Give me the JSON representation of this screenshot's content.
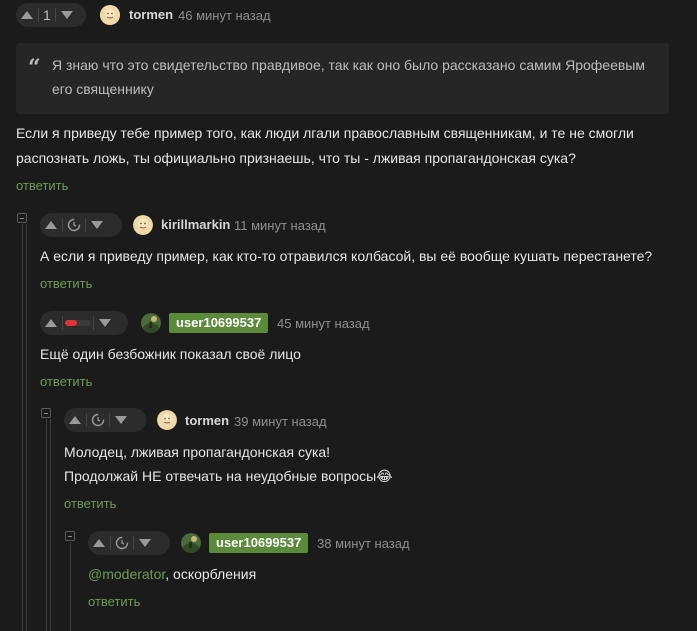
{
  "comments": [
    {
      "id": "c1",
      "rating": "1",
      "author": "tormen",
      "time": "46 минут назад",
      "quote": "Я знаю что это свидетельство правдивое, так как оно было рассказано самим Ярофеевым его священнику",
      "text_line1": "Если я приведу тебе пример того, как люди лгали православным священникам, и те не смогли",
      "text_line2": "распознать ложь, ты официально признаешь, что ты - лживая пропагандонская сука?",
      "reply": "ответить"
    },
    {
      "id": "c2",
      "author": "kirillmarkin",
      "time": "11 минут назад",
      "text": "А если я приведу пример, как кто-то отравился колбасой, вы её вообще кушать перестанете?",
      "reply": "ответить"
    },
    {
      "id": "c3",
      "author": "user10699537",
      "time": "45 минут назад",
      "rating_fill": 0.45,
      "text": "Ещё один безбожник показал своё лицо",
      "reply": "ответить"
    },
    {
      "id": "c4",
      "author": "tormen",
      "time": "39 минут назад",
      "text_line1": "Молодец, лживая пропагандонская сука!",
      "text_line2": "Продолжай НЕ отвечать на неудобные вопросы😂",
      "reply": "ответить"
    },
    {
      "id": "c5",
      "author": "user10699537",
      "time": "38 минут назад",
      "mention": "@moderator",
      "text": ", оскорбления",
      "reply": "ответить"
    }
  ],
  "colors": {
    "background": "#1b1b1b",
    "accent_green": "#6e9a55",
    "badge_green": "#5a8a3a",
    "rating_red": "#e03333"
  },
  "icons": [
    "upvote-icon",
    "downvote-icon",
    "clock-icon",
    "quote-icon",
    "collapse-icon"
  ]
}
